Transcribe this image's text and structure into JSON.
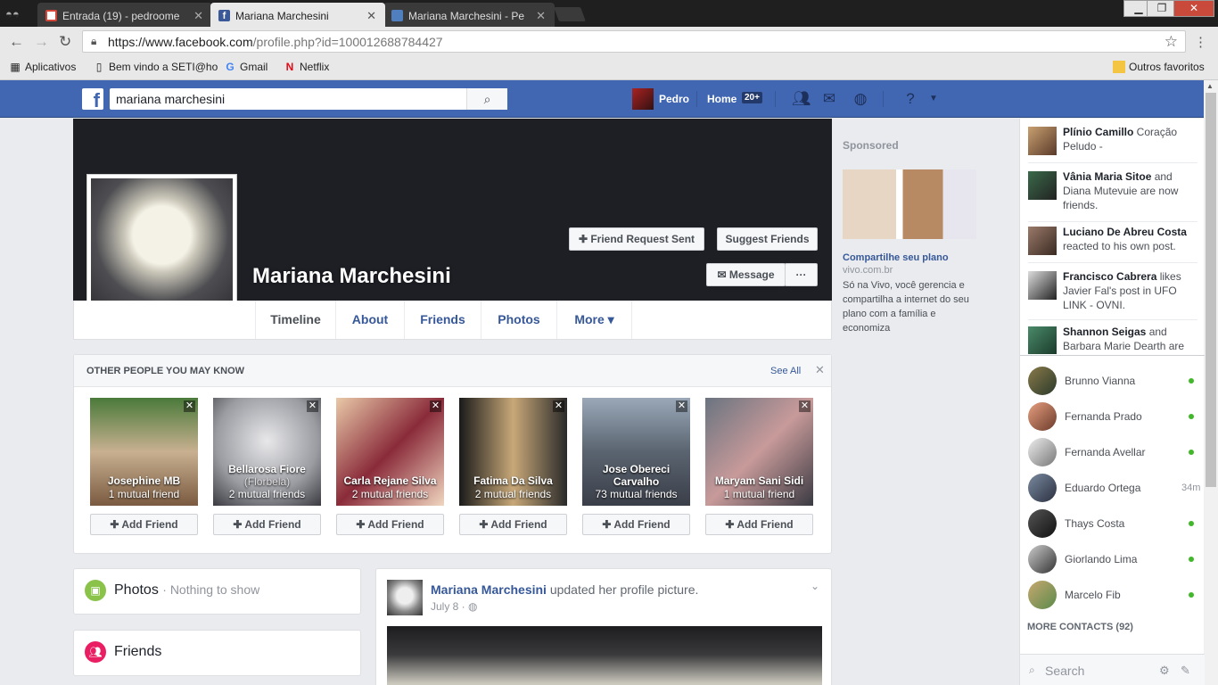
{
  "browser": {
    "tabs": [
      {
        "title": "Entrada (19) - pedroome",
        "icon": "gmail-icon"
      },
      {
        "title": "Mariana Marchesini",
        "icon": "facebook-icon"
      },
      {
        "title": "Mariana Marchesini - Pe",
        "icon": "page-icon"
      }
    ],
    "url_host": "https://www.facebook.com",
    "url_path": "/profile.php?id=100012688784427",
    "bookmarks": [
      "Aplicativos",
      "Bem vindo a SETI@ho",
      "Gmail",
      "Netflix"
    ],
    "other_bookmarks": "Outros favoritos"
  },
  "fbnav": {
    "search_value": "mariana marchesini",
    "user": "Pedro",
    "home": "Home",
    "home_badge": "20+"
  },
  "profile": {
    "name": "Mariana Marchesini",
    "friend_request_sent": "Friend Request Sent",
    "suggest_friends": "Suggest Friends",
    "message": "Message",
    "more_dots": "···",
    "tabs": [
      "Timeline",
      "About",
      "Friends",
      "Photos",
      "More ▾"
    ]
  },
  "pymk": {
    "title": "OTHER PEOPLE YOU MAY KNOW",
    "see_all": "See All",
    "add_label": "Add Friend",
    "people": [
      {
        "name": "Josephine MB",
        "sub": "",
        "mutual": "1 mutual friend"
      },
      {
        "name": "Bellarosa Fiore",
        "sub": "(Florbela)",
        "mutual": "2 mutual friends"
      },
      {
        "name": "Carla Rejane Silva",
        "sub": "",
        "mutual": "2 mutual friends"
      },
      {
        "name": "Fatima Da Silva",
        "sub": "",
        "mutual": "2 mutual friends"
      },
      {
        "name": "Jose Obereci Carvalho",
        "sub": "",
        "mutual": "73 mutual friends"
      },
      {
        "name": "Maryam Sani Sidi",
        "sub": "",
        "mutual": "1 mutual friend"
      }
    ]
  },
  "boxes": {
    "photos_title": "Photos",
    "photos_sub": "· Nothing to show",
    "friends_title": "Friends"
  },
  "post": {
    "author": "Mariana Marchesini",
    "action": " updated her profile picture.",
    "date": "July 8 · ◍"
  },
  "sponsored": {
    "title": "Sponsored",
    "headline": "Compartilhe seu plano",
    "url": "vivo.com.br",
    "body": "Só na Vivo, você gerencia e compartilha a internet do seu plano com a família e economiza"
  },
  "ticker": [
    {
      "name": "Plínio Camillo",
      "text": " Coração Peludo -"
    },
    {
      "name": "Vânia Maria Sitoe",
      "text": " and Diana Mutevuie are now friends."
    },
    {
      "name": "Luciano De Abreu Costa",
      "text": " reacted to his own post."
    },
    {
      "name": "Francisco Cabrera",
      "text": " likes Javier Fal's post in UFO LINK - OVNI."
    },
    {
      "name": "Shannon Seigas",
      "text": " and Barbara Marie Dearth are"
    }
  ],
  "contacts": [
    {
      "name": "Brunno Vianna",
      "ago": ""
    },
    {
      "name": "Fernanda Prado",
      "ago": ""
    },
    {
      "name": "Fernanda Avellar",
      "ago": ""
    },
    {
      "name": "Eduardo Ortega",
      "ago": "34m"
    },
    {
      "name": "Thays Costa",
      "ago": ""
    },
    {
      "name": "Giorlando Lima",
      "ago": ""
    },
    {
      "name": "Marcelo Fib",
      "ago": ""
    }
  ],
  "more_contacts": "MORE CONTACTS (92)",
  "chat_search_placeholder": "Search",
  "colors": {
    "fb_blue": "#4267b2",
    "link": "#365899",
    "online": "#42b72a"
  }
}
